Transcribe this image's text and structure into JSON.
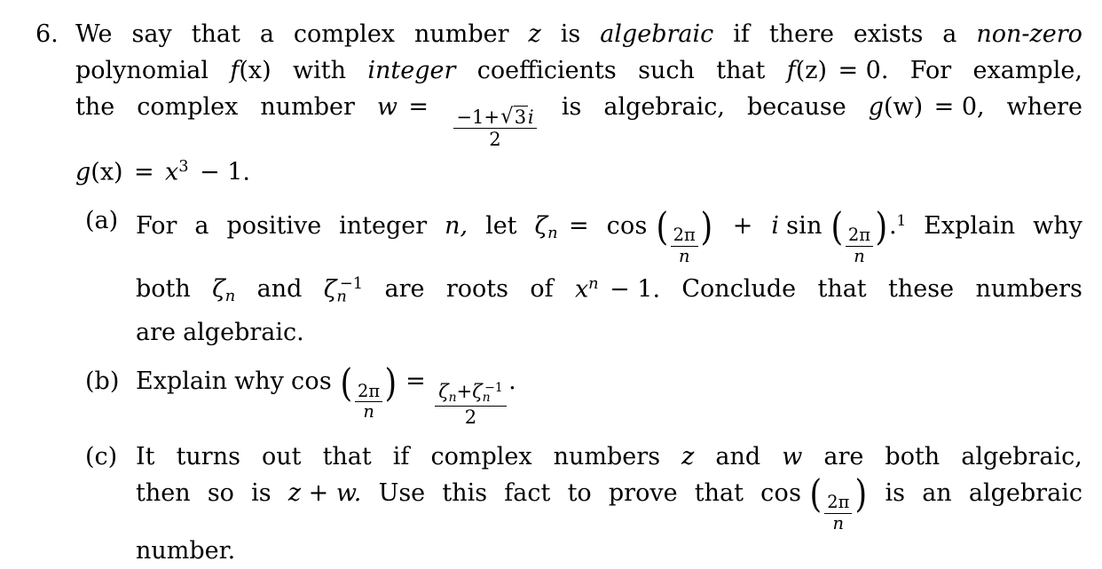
{
  "document": {
    "type": "math-problem-set",
    "problem_number": "6.",
    "statement": {
      "line1": {
        "w1": "We",
        "w2": "say",
        "w3": "that",
        "w4": "a",
        "w5": "complex",
        "w6": "number",
        "w7": "z",
        "w8": "is",
        "w9": "algebraic",
        "w10": "if",
        "w11": "there",
        "w12": "exists",
        "w13": "a",
        "w14": "non-zero"
      },
      "line2": {
        "w1": "polynomial",
        "w2": "f",
        "w2b": "(x)",
        "w3": "with",
        "w4": "integer",
        "w5": "coefficients",
        "w6": "such",
        "w7": "that",
        "w8": "f",
        "w8b": "(z)",
        "w8c": "= 0.",
        "w9": "For",
        "w10": "example,"
      },
      "line3": {
        "w1": "the",
        "w2": "complex",
        "w3": "number",
        "w4": "w",
        "w4b": "=",
        "frac_num_sign": "−1+",
        "frac_num_sqrt": "3",
        "frac_num_i": "i",
        "frac_den": "2",
        "w5": "is",
        "w6": "algebraic,",
        "w7": "because",
        "w8": "g",
        "w8b": "(w)",
        "w8c": "= 0,",
        "w9": "where"
      },
      "line4": {
        "g": "g",
        "gx": "(x)",
        "eq": "=",
        "x": "x",
        "pow": "3",
        "minus": "− 1."
      }
    },
    "parts": [
      {
        "label": "(a)",
        "lines": [
          {
            "w1": "For",
            "w2": "a",
            "w3": "positive",
            "w4": "integer",
            "w5": "n,",
            "w6": "let",
            "zeta": "ζ",
            "zeta_sub": "n",
            "eq": "=",
            "cos": "cos",
            "frac1_num": "2π",
            "frac1_den": "n",
            "plus": "+",
            "i": "i",
            "sin": "sin",
            "frac2_num": "2π",
            "frac2_den": "n",
            "period": ".",
            "footnote_mark": "1",
            "w7": "Explain",
            "w8": "why"
          },
          {
            "w1": "both",
            "zeta1": "ζ",
            "zeta1_sub": "n",
            "w2": "and",
            "zeta2": "ζ",
            "zeta2_sub": "n",
            "zeta2_sup": "−1",
            "w3": "are",
            "w4": "roots",
            "w5": "of",
            "x": "x",
            "x_sup": "n",
            "w6": "− 1.",
            "w7": "Conclude",
            "w8": "that",
            "w9": "these",
            "w10": "numbers"
          },
          {
            "w1": "are",
            "w2": "algebraic."
          }
        ]
      },
      {
        "label": "(b)",
        "lines": [
          {
            "w1": "Explain",
            "w2": "why",
            "cos": "cos",
            "frac1_num": "2π",
            "frac1_den": "n",
            "eq": "=",
            "frac2_num_z1": "ζ",
            "frac2_num_z1sub": "n",
            "frac2_num_plus": "+",
            "frac2_num_z2": "ζ",
            "frac2_num_z2sub": "n",
            "frac2_num_z2sup": "−1",
            "frac2_den": "2",
            "period": "."
          }
        ]
      },
      {
        "label": "(c)",
        "lines": [
          {
            "w1": "It",
            "w2": "turns",
            "w3": "out",
            "w4": "that",
            "w5": "if",
            "w6": "complex",
            "w7": "numbers",
            "z": "z",
            "w8": "and",
            "w9": "w",
            "w10": "are",
            "w11": "both",
            "w12": "algebraic,"
          },
          {
            "w1": "then",
            "w2": "so",
            "w3": "is",
            "zw": "z + w.",
            "w4": "Use",
            "w5": "this",
            "w6": "fact",
            "w7": "to",
            "w8": "prove",
            "w9": "that",
            "cos": "cos",
            "frac_num": "2π",
            "frac_den": "n",
            "w10": "is",
            "w11": "an",
            "w12": "algebraic"
          },
          {
            "w1": "number."
          }
        ]
      }
    ]
  }
}
